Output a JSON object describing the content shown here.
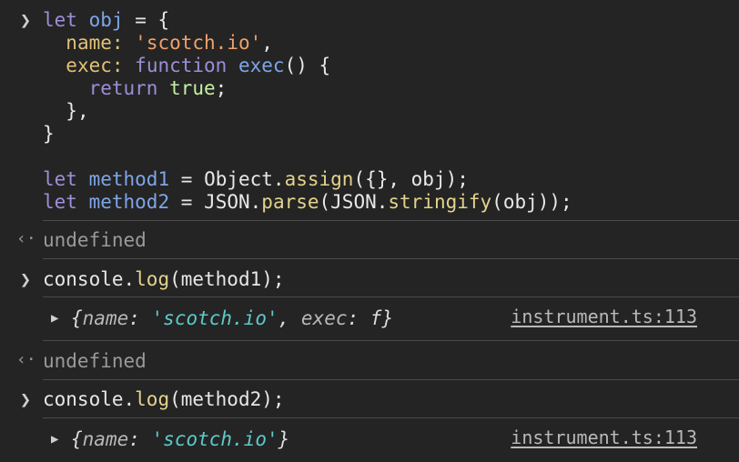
{
  "input1": {
    "l1": [
      "let",
      "obj",
      "=",
      "{"
    ],
    "l2": [
      "name:",
      "'scotch.io'",
      ","
    ],
    "l3": [
      "exec:",
      "function",
      "exec",
      "()",
      "{"
    ],
    "l4": [
      "return",
      "true",
      ";"
    ],
    "l5": "},",
    "l6": "}",
    "l8": [
      "let",
      "method1",
      "=",
      "Object.",
      "assign",
      "({}, obj);"
    ],
    "l9": [
      "let",
      "method2",
      "=",
      "JSON.",
      "parse",
      "(JSON.",
      "stringify",
      "(obj));"
    ]
  },
  "result1": "undefined",
  "input2": [
    "console.",
    "log",
    "(method1);"
  ],
  "log1": {
    "open": "{",
    "key1": "name",
    "colon1": ": ",
    "val1": "'scotch.io'",
    "comma": ", ",
    "key2": "exec",
    "colon2": ": ",
    "val2": "f",
    "close": "}",
    "source": "instrument.ts:113"
  },
  "result2": "undefined",
  "input3": [
    "console.",
    "log",
    "(method2);"
  ],
  "log2": {
    "open": "{",
    "key1": "name",
    "colon1": ": ",
    "val1": "'scotch.io'",
    "close": "}",
    "source": "instrument.ts:113"
  },
  "icons": {
    "prompt": "chevron-right-icon",
    "result": "return-arrow-icon",
    "expand": "triangle-right-icon"
  }
}
